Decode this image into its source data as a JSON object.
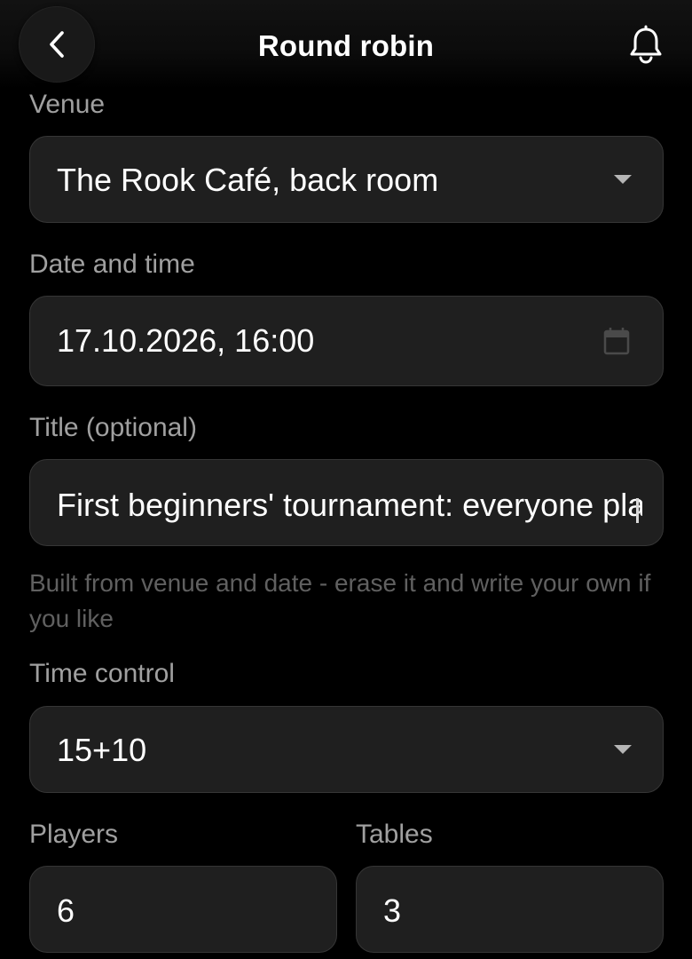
{
  "header": {
    "title": "Round robin",
    "back_icon": "chevron-left-icon",
    "notifications_icon": "bell-icon"
  },
  "form": {
    "venue": {
      "label": "Venue",
      "value": "The Rook Café, back room",
      "icon": "caret-down-icon"
    },
    "datetime": {
      "label": "Date and time",
      "value": "17.10.2026, 16:00",
      "icon": "calendar-icon"
    },
    "title": {
      "label": "Title (optional)",
      "value": "First beginners' tournament: everyone plays everyone",
      "helper": "Built from venue and date - erase it and write your own if you like"
    },
    "time_control": {
      "label": "Time control",
      "value": "15+10",
      "icon": "caret-down-icon"
    },
    "players": {
      "label": "Players",
      "value": "6"
    },
    "tables": {
      "label": "Tables",
      "value": "3"
    }
  },
  "colors": {
    "background": "#000000",
    "field_background": "#1f1f1f",
    "field_border": "#363636",
    "label": "#a0a0a0",
    "helper_text": "#606060",
    "value_text": "#ffffff"
  }
}
